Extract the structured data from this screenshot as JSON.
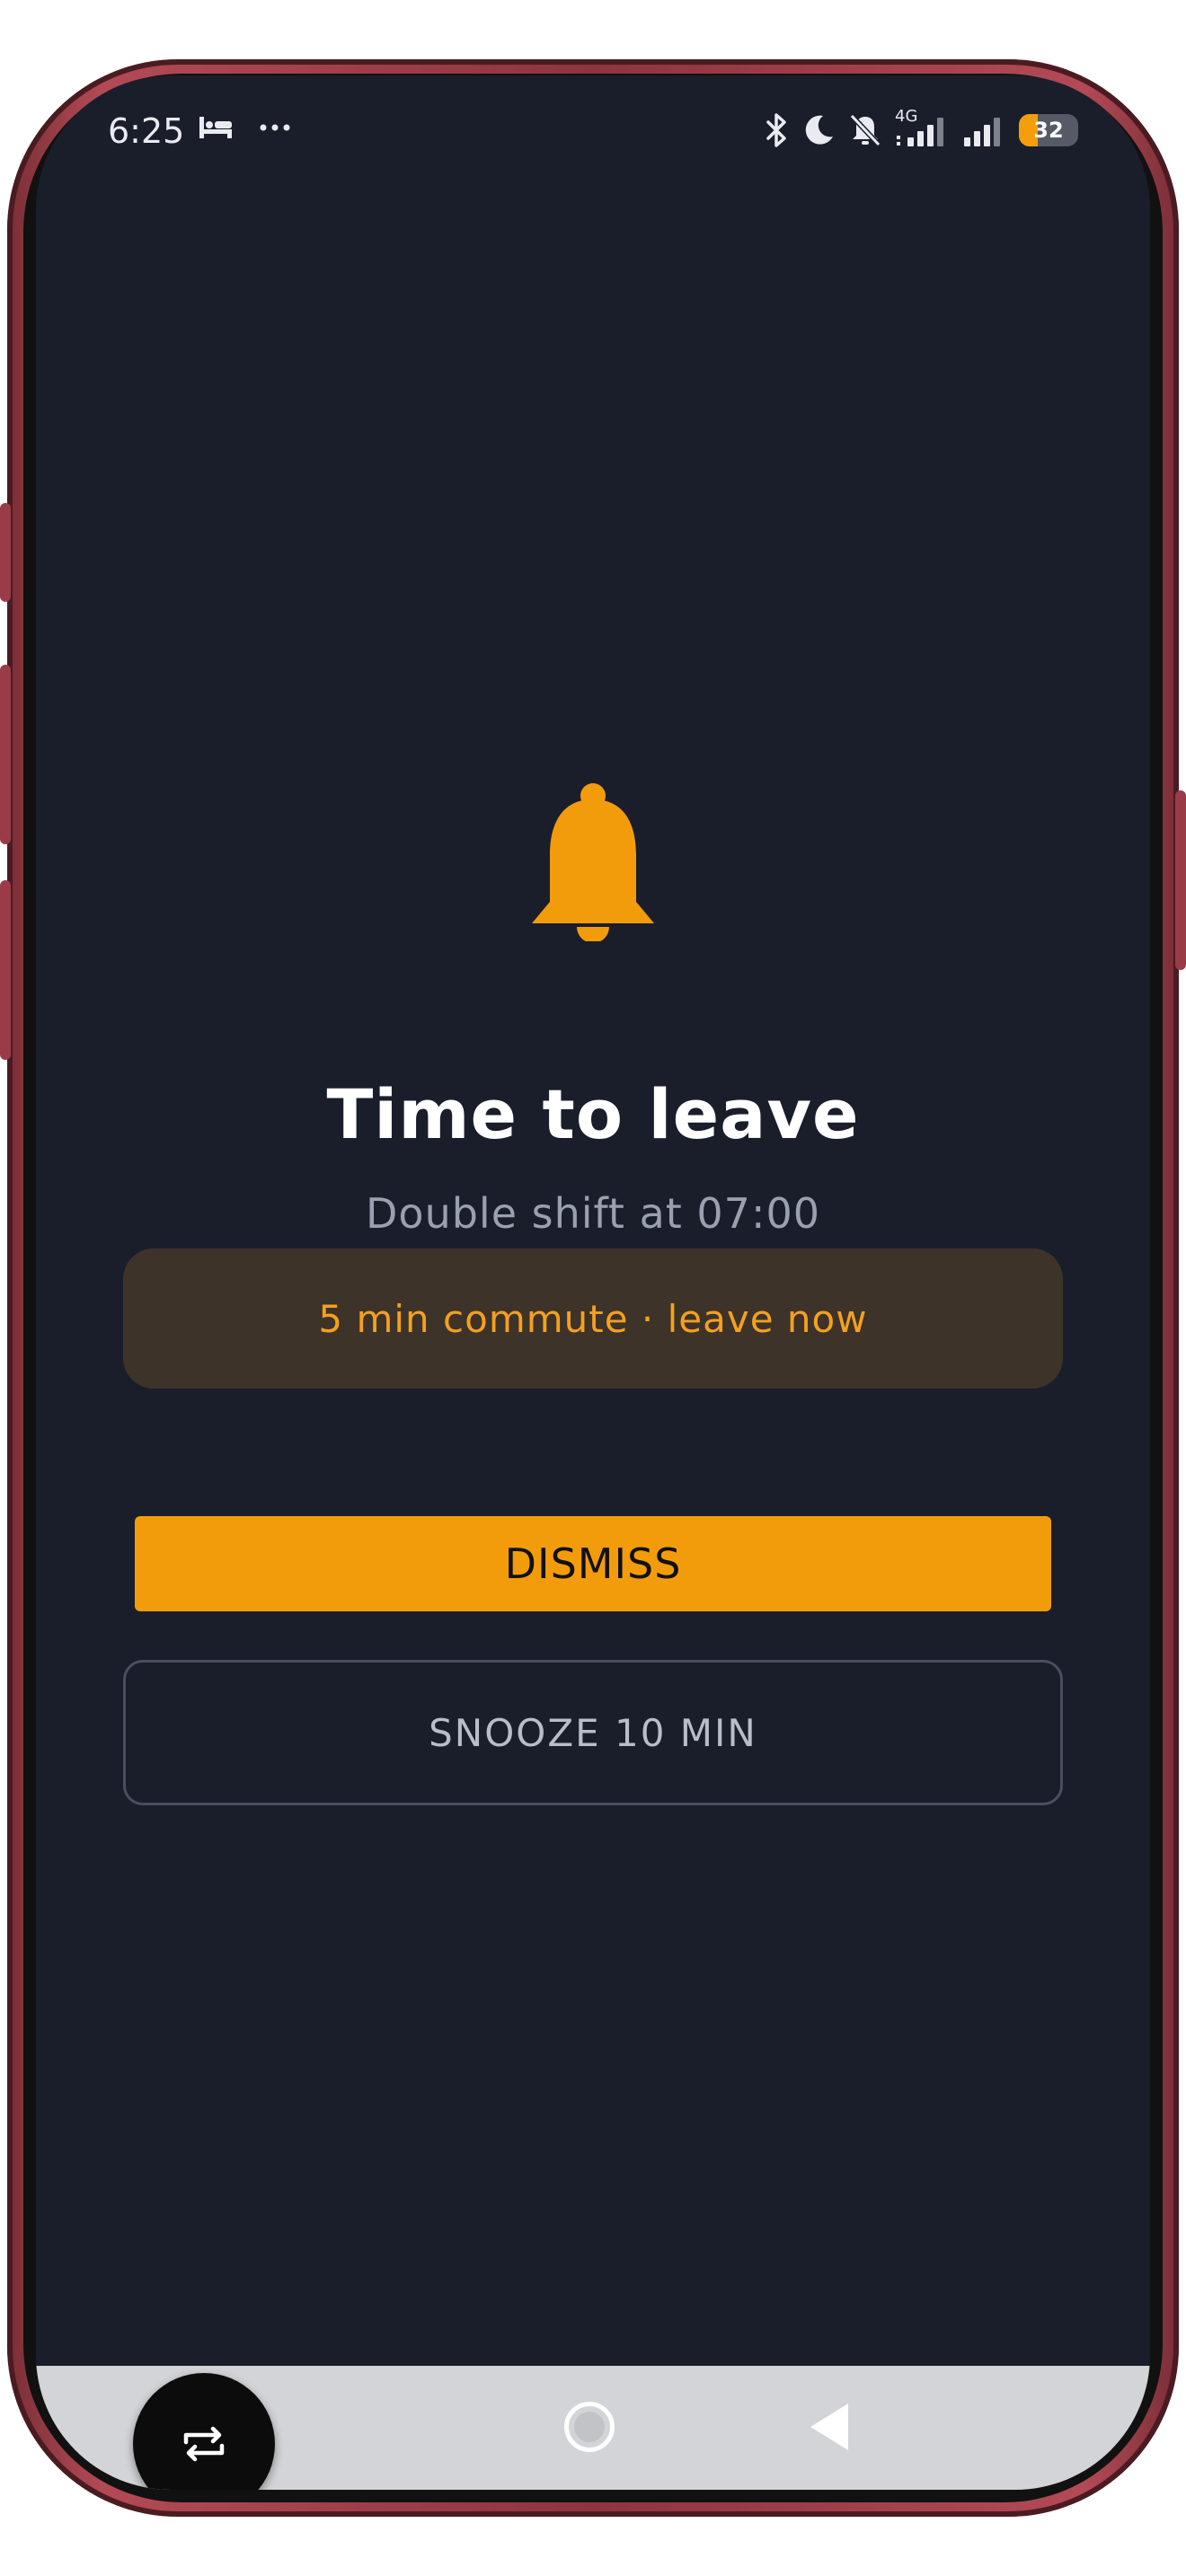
{
  "status_bar": {
    "time": "6:25",
    "battery_level": "32",
    "network_type": "4G",
    "icons": [
      "bed-icon",
      "more-dots-icon",
      "bluetooth-icon",
      "moon-icon",
      "bell-off-icon",
      "signal-4g-icon",
      "signal-icon",
      "battery-icon"
    ]
  },
  "alarm": {
    "icon": "bell-icon",
    "title": "Time to leave",
    "subtitle": "Double shift at 07:00",
    "commute_message": "5 min commute · leave now"
  },
  "actions": {
    "dismiss_label": "DISMISS",
    "snooze_label": "SNOOZE 10 MIN"
  },
  "navigation": {
    "home": "home-icon",
    "back": "back-icon"
  },
  "floating": {
    "icon": "rotate-screen-icon"
  },
  "colors": {
    "background": "#1a1e2b",
    "accent": "#f39c0b",
    "banner": "#3d3329",
    "subtitle": "#9aa0b0",
    "nav_bar": "#d3d4d7",
    "phone_frame": "#8e3440"
  }
}
